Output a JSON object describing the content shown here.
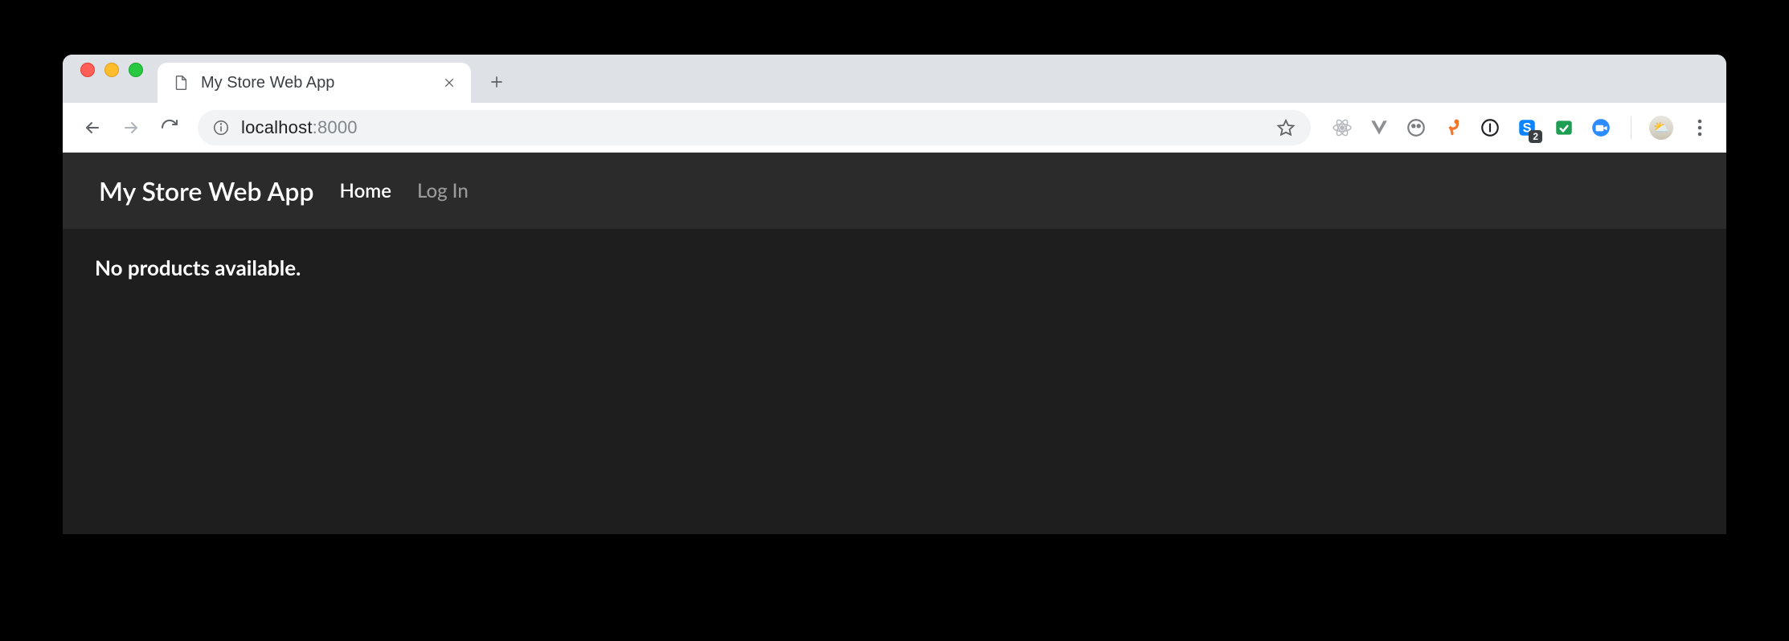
{
  "browser": {
    "tab": {
      "title": "My Store Web App"
    },
    "url": {
      "host": "localhost",
      "port": ":8000"
    },
    "extensions": {
      "react": {
        "name": "react-devtools-icon"
      },
      "vue": {
        "name": "vue-devtools-icon"
      },
      "ghostery": {
        "name": "ghostery-icon"
      },
      "hook": {
        "name": "hook-icon"
      },
      "onepass": {
        "name": "onepassword-icon"
      },
      "skype": {
        "name": "skype-icon",
        "badge": "2"
      },
      "green": {
        "name": "green-shield-icon"
      },
      "zoom": {
        "name": "zoom-icon"
      }
    }
  },
  "app": {
    "brand": "My Store Web App",
    "nav": {
      "home": "Home",
      "login": "Log In"
    },
    "empty_message": "No products available."
  }
}
